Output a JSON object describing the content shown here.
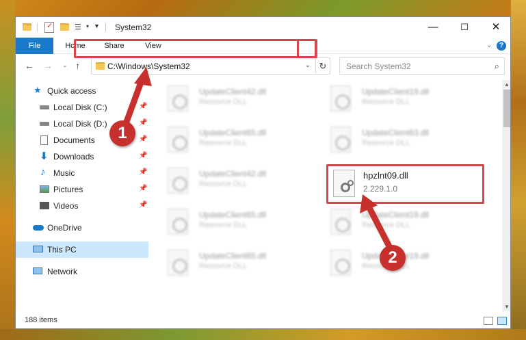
{
  "window": {
    "title": "System32"
  },
  "ribbon": {
    "tabs": [
      {
        "label": "File"
      },
      {
        "label": "Home"
      },
      {
        "label": "Share"
      },
      {
        "label": "View"
      }
    ]
  },
  "address_bar": {
    "path": "C:\\Windows\\System32"
  },
  "search": {
    "placeholder": "Search System32"
  },
  "sidebar": {
    "items": [
      {
        "label": "Quick access",
        "icon": "star-icon"
      },
      {
        "label": "Local Disk (C:)",
        "icon": "drive-icon"
      },
      {
        "label": "Local Disk (D:)",
        "icon": "drive-icon"
      },
      {
        "label": "Documents",
        "icon": "documents-icon"
      },
      {
        "label": "Downloads",
        "icon": "download-icon"
      },
      {
        "label": "Music",
        "icon": "music-icon"
      },
      {
        "label": "Pictures",
        "icon": "pictures-icon"
      },
      {
        "label": "Videos",
        "icon": "videos-icon"
      },
      {
        "label": "OneDrive",
        "icon": "cloud-icon"
      },
      {
        "label": "This PC",
        "icon": "computer-icon"
      },
      {
        "label": "Network",
        "icon": "network-icon"
      }
    ]
  },
  "files": [
    {
      "name": "UpdateClient42.dll",
      "type": "Resource DLL"
    },
    {
      "name": "UpdateClient19.dll",
      "type": "Resource DLL"
    },
    {
      "name": "UpdateClient65.dll",
      "type": "Resource DLL"
    },
    {
      "name": "UpdateClient63.dll",
      "type": "Resource DLL"
    },
    {
      "name": "UpdateClient42.dll",
      "type": "Resource DLL"
    },
    {
      "name": "UpdateClient65.dll",
      "type": "Resource DLL"
    },
    {
      "name": "UpdateClient19.dll",
      "type": "Resource DLL"
    },
    {
      "name": "UpdateClient65.dll",
      "type": "Resource DLL"
    },
    {
      "name": "UpdateClient19.dll",
      "type": "Resource DLL"
    }
  ],
  "highlighted_file": {
    "name": "hpzlnt09.dll",
    "version": "2.229.1.0"
  },
  "status": {
    "item_count": "188 items"
  },
  "annotations": {
    "step1": "1",
    "step2": "2",
    "highlight_color": "#d9454a"
  }
}
